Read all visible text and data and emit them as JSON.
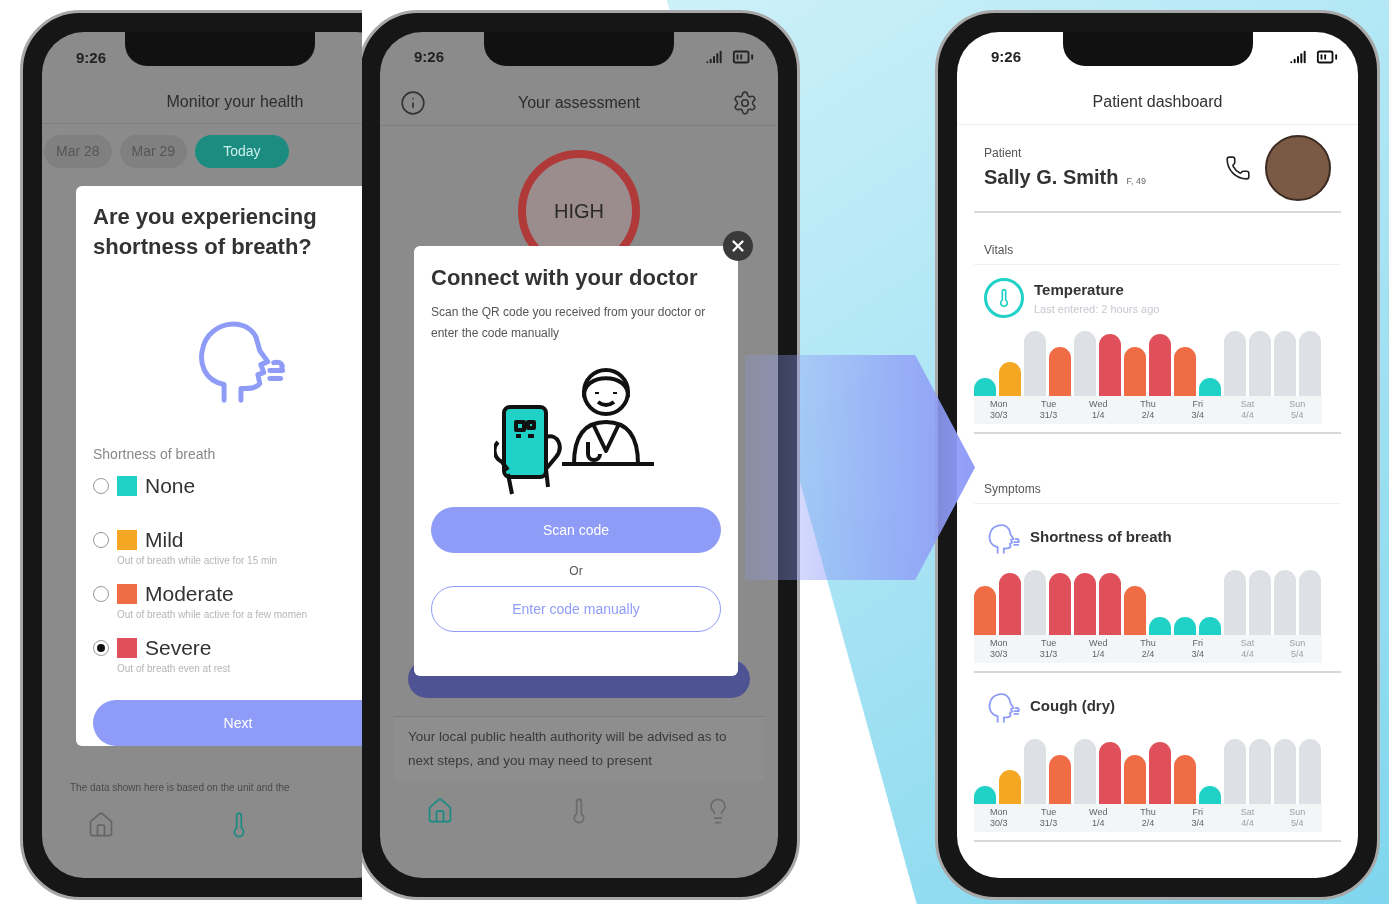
{
  "health_screen": {
    "time": "9:26",
    "title": "Monitor your health",
    "dates": [
      {
        "label": "Mar 28",
        "selected": false
      },
      {
        "label": "Mar 29",
        "selected": false
      },
      {
        "label": "Today",
        "selected": true
      }
    ],
    "question": {
      "title": "Are you experiencing shortness of breath?",
      "scale_label": "Shortness of breath",
      "options": [
        {
          "label": "None",
          "color": "#1fd1c6",
          "selected": false
        },
        {
          "label": "Mild",
          "description": "Out of breath while active for 15 min",
          "color": "#f5a623",
          "selected": false
        },
        {
          "label": "Moderate",
          "description": "Out of breath while active for a few momen",
          "color": "#ef6c45",
          "selected": false
        },
        {
          "label": "Severe",
          "description": "Out of breath even at rest",
          "color": "#e0505a",
          "selected": true
        }
      ],
      "button": "Next"
    },
    "footnote": "The data shown here is based on the unit and the",
    "tab_bar": [
      {
        "selected": false
      },
      {
        "selected": true
      }
    ]
  },
  "assessment_screen": {
    "time": "9:26",
    "title": "Your assessment",
    "risk": "HIGH",
    "dialog": {
      "title": "Connect with your doctor",
      "text": "Scan the QR code you received from your doctor or enter the code manually",
      "primary_button": "Scan code",
      "separator": "Or",
      "secondary_button": "Enter code manually"
    },
    "info_text": "Your local public health authority will be advised as to next steps, and you may need to present",
    "tab_bar": [
      {
        "selected": true
      },
      {
        "selected": false
      },
      {
        "selected": false
      }
    ]
  },
  "dashboard_screen": {
    "time": "9:26",
    "title": "Patient dashboard",
    "patient": {
      "label": "Patient",
      "name": "Sally G. Smith",
      "details": "F, 49"
    },
    "vitals": {
      "heading": "Vitals",
      "items": [
        {
          "name": "Temperature",
          "subtitle": "Last entered: 2 hours ago",
          "bars": [
            {
              "color": "#1fd1c6",
              "level": 0.28
            },
            {
              "color": "#f5a623",
              "level": 0.52
            },
            {
              "color": "#dde1e6",
              "level": 1
            },
            {
              "color": "#ef6c45",
              "level": 0.75
            },
            {
              "color": "#dde1e6",
              "level": 1
            },
            {
              "color": "#e0505a",
              "level": 0.95
            },
            {
              "color": "#ef6c45",
              "level": 0.75
            },
            {
              "color": "#e0505a",
              "level": 0.95
            },
            {
              "color": "#ef6c45",
              "level": 0.75
            },
            {
              "color": "#1fd1c6",
              "level": 0.28
            },
            {
              "color": "#dde1e6",
              "level": 1
            },
            {
              "color": "#dde1e6",
              "level": 1
            },
            {
              "color": "#dde1e6",
              "level": 1
            },
            {
              "color": "#dde1e6",
              "level": 1
            }
          ],
          "days": [
            {
              "day": "Mon",
              "date": "30/3",
              "dim": false
            },
            {
              "day": "Tue",
              "date": "31/3",
              "dim": false
            },
            {
              "day": "Wed",
              "date": "1/4",
              "dim": false
            },
            {
              "day": "Thu",
              "date": "2/4",
              "dim": false
            },
            {
              "day": "Fri",
              "date": "3/4",
              "dim": false
            },
            {
              "day": "Sat",
              "date": "4/4",
              "dim": true
            },
            {
              "day": "Sun",
              "date": "5/4",
              "dim": true
            }
          ]
        }
      ]
    },
    "symptoms": {
      "heading": "Symptoms",
      "items": [
        {
          "name": "Shortness of breath",
          "bars": [
            {
              "color": "#ef6c45",
              "level": 0.75
            },
            {
              "color": "#e0505a",
              "level": 0.95
            },
            {
              "color": "#dde1e6",
              "level": 1
            },
            {
              "color": "#e0505a",
              "level": 0.95
            },
            {
              "color": "#e0505a",
              "level": 0.95
            },
            {
              "color": "#e0505a",
              "level": 0.95
            },
            {
              "color": "#ef6c45",
              "level": 0.75
            },
            {
              "color": "#1fd1c6",
              "level": 0.28
            },
            {
              "color": "#1fd1c6",
              "level": 0.28
            },
            {
              "color": "#1fd1c6",
              "level": 0.28
            },
            {
              "color": "#dde1e6",
              "level": 1
            },
            {
              "color": "#dde1e6",
              "level": 1
            },
            {
              "color": "#dde1e6",
              "level": 1
            },
            {
              "color": "#dde1e6",
              "level": 1
            }
          ],
          "days": [
            {
              "day": "Mon",
              "date": "30/3",
              "dim": false
            },
            {
              "day": "Tue",
              "date": "31/3",
              "dim": false
            },
            {
              "day": "Wed",
              "date": "1/4",
              "dim": false
            },
            {
              "day": "Thu",
              "date": "2/4",
              "dim": false
            },
            {
              "day": "Fri",
              "date": "3/4",
              "dim": false
            },
            {
              "day": "Sat",
              "date": "4/4",
              "dim": true
            },
            {
              "day": "Sun",
              "date": "5/4",
              "dim": true
            }
          ]
        },
        {
          "name": "Cough (dry)",
          "bars": [
            {
              "color": "#1fd1c6",
              "level": 0.28
            },
            {
              "color": "#f5a623",
              "level": 0.52
            },
            {
              "color": "#dde1e6",
              "level": 1
            },
            {
              "color": "#ef6c45",
              "level": 0.75
            },
            {
              "color": "#dde1e6",
              "level": 1
            },
            {
              "color": "#e0505a",
              "level": 0.95
            },
            {
              "color": "#ef6c45",
              "level": 0.75
            },
            {
              "color": "#e0505a",
              "level": 0.95
            },
            {
              "color": "#ef6c45",
              "level": 0.75
            },
            {
              "color": "#1fd1c6",
              "level": 0.28
            },
            {
              "color": "#dde1e6",
              "level": 1
            },
            {
              "color": "#dde1e6",
              "level": 1
            },
            {
              "color": "#dde1e6",
              "level": 1
            },
            {
              "color": "#dde1e6",
              "level": 1
            }
          ],
          "days": [
            {
              "day": "Mon",
              "date": "30/3",
              "dim": false
            },
            {
              "day": "Tue",
              "date": "31/3",
              "dim": false
            },
            {
              "day": "Wed",
              "date": "1/4",
              "dim": false
            },
            {
              "day": "Thu",
              "date": "2/4",
              "dim": false
            },
            {
              "day": "Fri",
              "date": "3/4",
              "dim": false
            },
            {
              "day": "Sat",
              "date": "4/4",
              "dim": true
            },
            {
              "day": "Sun",
              "date": "5/4",
              "dim": true
            }
          ]
        }
      ]
    }
  }
}
